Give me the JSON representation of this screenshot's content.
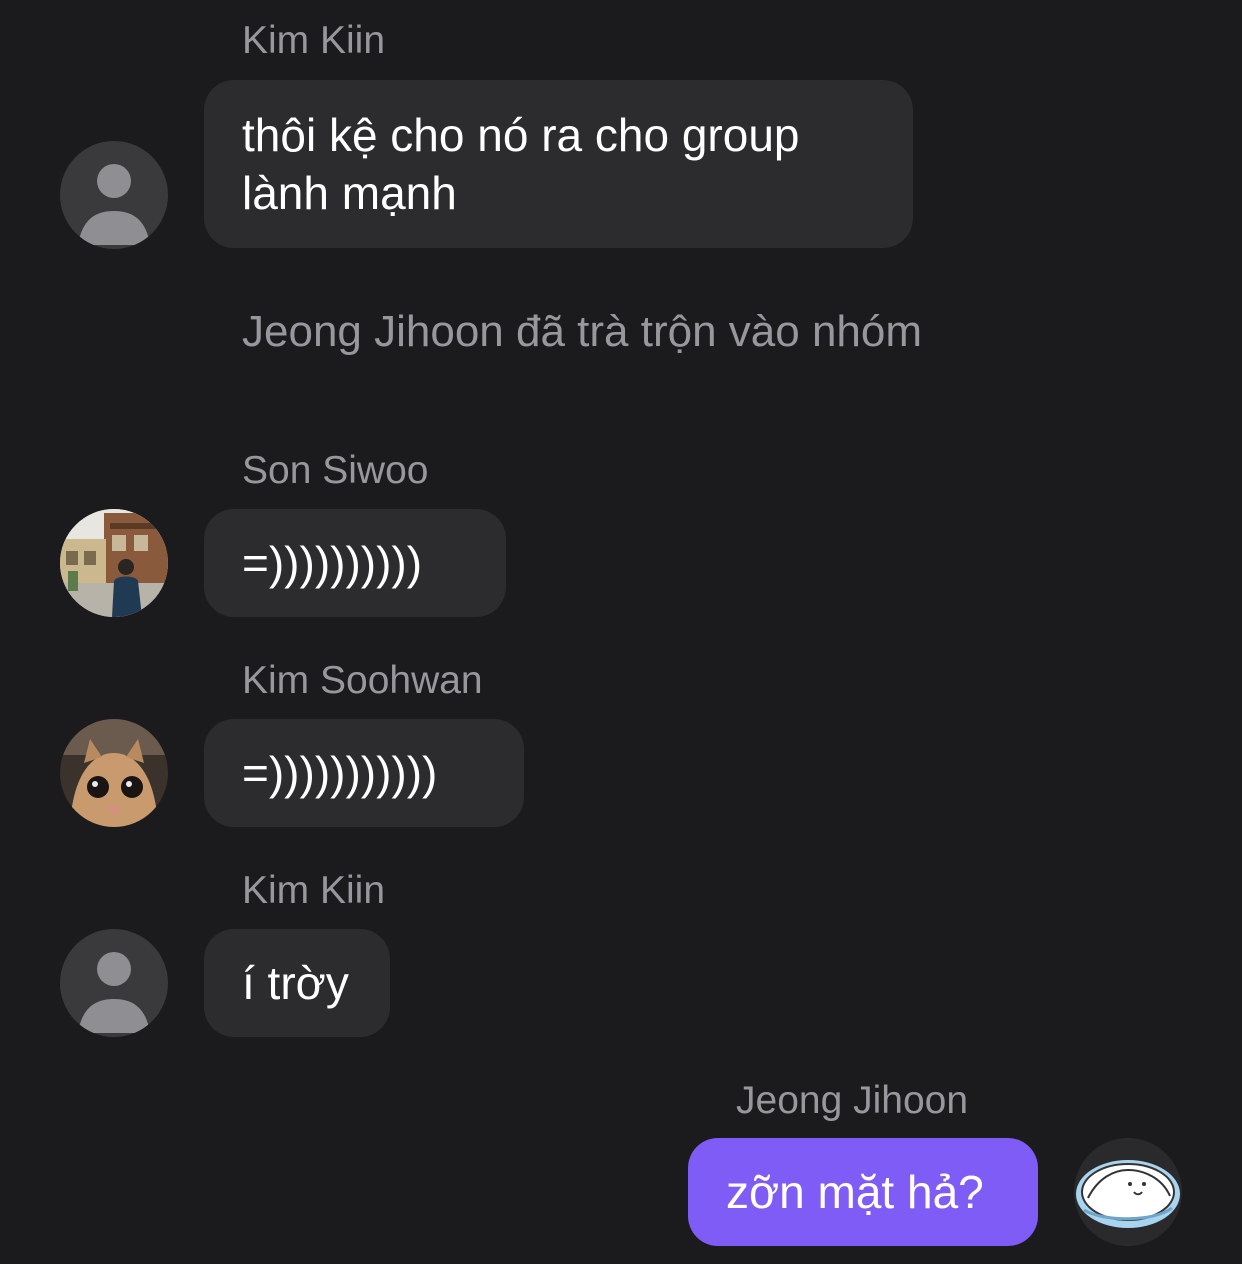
{
  "messages": [
    {
      "sender": "Kim Kiin",
      "text": "thôi kệ cho nó ra cho group lành mạnh",
      "avatar": "default-person-icon"
    },
    {
      "system": "Jeong Jihoon đã trà trộn vào nhóm"
    },
    {
      "sender": "Son Siwoo",
      "text": "=))))))))))",
      "avatar": "photo-avatar-street"
    },
    {
      "sender": "Kim Soohwan",
      "text": "=)))))))))))",
      "avatar": "photo-avatar-cat"
    },
    {
      "sender": "Kim Kiin",
      "text": "í trờy",
      "avatar": "default-person-icon"
    },
    {
      "sender": "Jeong Jihoon",
      "text": "zỡn mặt hả?",
      "avatar": "cartoon-sticker-avatar",
      "mine": true
    }
  ],
  "colors": {
    "background": "#1b1b1d",
    "incoming_bubble": "#2c2c2e",
    "outgoing_bubble": "#7f5cf6",
    "secondary_text": "#98979d"
  }
}
